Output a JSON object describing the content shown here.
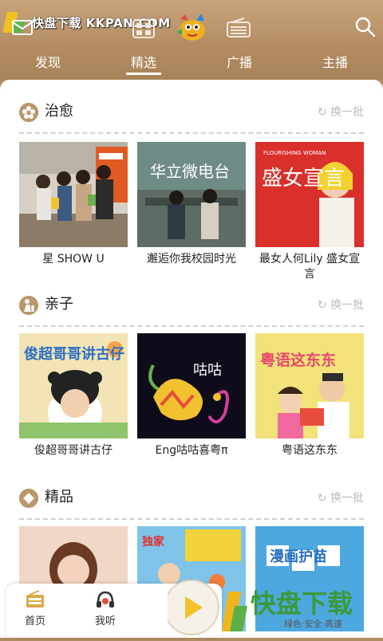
{
  "watermark": {
    "text": "快盘下载 KKPAN.COM"
  },
  "topbar": {
    "icons": [
      "mail-icon",
      "grid-icon",
      "mascot-logo",
      "radio-icon",
      "search-icon"
    ]
  },
  "tabs": [
    {
      "label": "发现",
      "active": false
    },
    {
      "label": "精选",
      "active": true
    },
    {
      "label": "广播",
      "active": false
    },
    {
      "label": "主播",
      "active": false
    }
  ],
  "sections": [
    {
      "title": "治愈",
      "refresh": "换一批",
      "icon": "flower-icon",
      "items": [
        {
          "caption": "星 SHOW U"
        },
        {
          "caption": "邂逅你我校园时光",
          "overlay": "华立微电台"
        },
        {
          "caption": "最女人何Lily 盛女宣言",
          "overlay": "盛女宣言",
          "overlay_small": "FLOURISHING WOMAN"
        }
      ]
    },
    {
      "title": "亲子",
      "refresh": "换一批",
      "icon": "child-icon",
      "items": [
        {
          "caption": "俊超哥哥讲古仔",
          "overlay": "俊超哥哥讲古仔"
        },
        {
          "caption": "Eng咕咕喜粤π",
          "overlay": "咕咕"
        },
        {
          "caption": "粤语这东东",
          "overlay": "粤语这东东"
        }
      ]
    },
    {
      "title": "精品",
      "refresh": "换一批",
      "icon": "diamond-icon",
      "items": [
        {
          "caption": ""
        },
        {
          "caption": "",
          "overlay": "独家"
        },
        {
          "caption": "",
          "overlay": "漫画护苗"
        }
      ]
    }
  ],
  "bottom_nav": [
    {
      "label": "首页",
      "icon": "radio-home-icon"
    },
    {
      "label": "我听",
      "icon": "headphone-icon"
    }
  ],
  "ad": {
    "big": "快盘下载",
    "small": "绿色·安全·高速"
  },
  "colors": {
    "accent": "#b9976b",
    "header": "#b48d63"
  }
}
